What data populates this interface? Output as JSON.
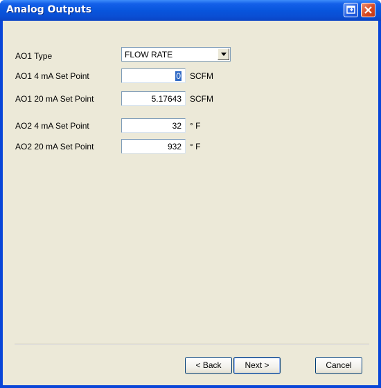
{
  "window": {
    "title": "Analog Outputs"
  },
  "form": {
    "ao1_type": {
      "label": "AO1 Type",
      "value": "FLOW RATE"
    },
    "ao1_4ma": {
      "label": "AO1 4 mA Set Point",
      "value": "0",
      "unit": "SCFM"
    },
    "ao1_20ma": {
      "label": "AO1 20 mA Set Point",
      "value": "5.17643",
      "unit": "SCFM"
    },
    "ao2_4ma": {
      "label": "AO2 4 mA Set Point",
      "value": "32",
      "unit": "° F"
    },
    "ao2_20ma": {
      "label": "AO2 20 mA Set Point",
      "value": "932",
      "unit": "° F"
    }
  },
  "buttons": {
    "back": "< Back",
    "next": "Next >",
    "cancel": "Cancel"
  },
  "colors": {
    "titlebar": "#0a4ed3",
    "client": "#ece9d8",
    "selection": "#316ac5"
  },
  "icons": [
    "restore-icon",
    "close-icon",
    "dropdown-arrow-icon"
  ]
}
